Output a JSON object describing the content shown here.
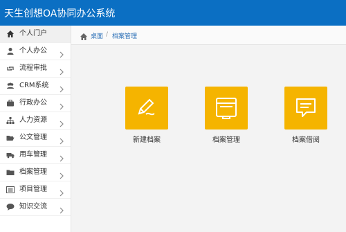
{
  "header": {
    "title": "天生创想OA协同办公系统"
  },
  "sidebar": {
    "items": [
      {
        "label": "个人门户",
        "icon": "home-icon",
        "active": true
      },
      {
        "label": "个人办公",
        "icon": "user-icon"
      },
      {
        "label": "流程审批",
        "icon": "retweet-icon"
      },
      {
        "label": "CRM系统",
        "icon": "users-icon"
      },
      {
        "label": "行政办公",
        "icon": "briefcase-icon"
      },
      {
        "label": "人力资源",
        "icon": "sitemap-icon"
      },
      {
        "label": "公文管理",
        "icon": "folder-open-icon"
      },
      {
        "label": "用车管理",
        "icon": "truck-icon"
      },
      {
        "label": "档案管理",
        "icon": "folder-icon"
      },
      {
        "label": "项目管理",
        "icon": "list-icon"
      },
      {
        "label": "知识交流",
        "icon": "comment-icon"
      }
    ]
  },
  "breadcrumb": {
    "home": "桌面",
    "separator": "/",
    "current": "档案管理"
  },
  "tiles": [
    {
      "label": "新建档案",
      "icon": "edit-icon"
    },
    {
      "label": "档案管理",
      "icon": "folder-manage-icon"
    },
    {
      "label": "档案借阅",
      "icon": "message-icon"
    }
  ],
  "colors": {
    "header": "#0b6fc3",
    "tile": "#f5b400",
    "link": "#2a6fb6"
  }
}
